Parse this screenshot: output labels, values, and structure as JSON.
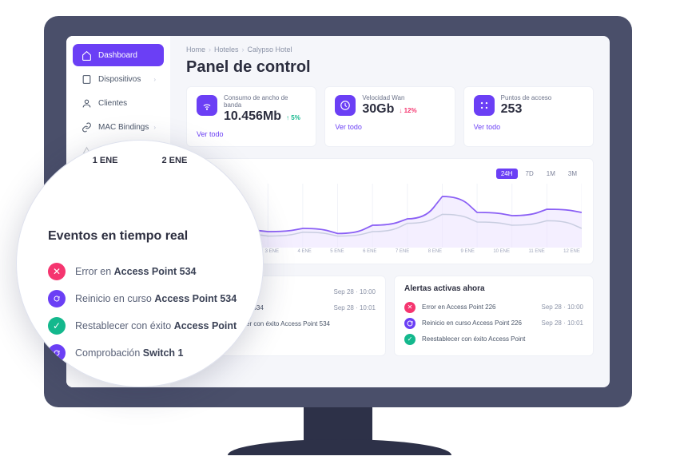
{
  "breadcrumbs": [
    "Home",
    "Hoteles",
    "Calypso Hotel"
  ],
  "pageTitle": "Panel de control",
  "sidebar": {
    "items": [
      {
        "label": "Dashboard",
        "icon": "home",
        "active": true
      },
      {
        "label": "Dispositivos",
        "icon": "device",
        "chev": true
      },
      {
        "label": "Clientes",
        "icon": "user",
        "chev": false
      },
      {
        "label": "MAC Bindings",
        "icon": "link",
        "chev": true
      },
      {
        "label": "",
        "icon": "warn",
        "chev": true
      }
    ]
  },
  "stats": [
    {
      "label": "Consumo de ancho de banda",
      "value": "10.456Mb",
      "change": "5%",
      "dir": "up",
      "icon": "wifi",
      "link": "Ver todo"
    },
    {
      "label": "Velocidad Wan",
      "value": "30Gb",
      "change": "12%",
      "dir": "down",
      "icon": "speed",
      "link": "Ver todo"
    },
    {
      "label": "Puntos de acceso",
      "value": "253",
      "change": "",
      "dir": "",
      "icon": "grid",
      "link": "Ver todo"
    }
  ],
  "chart": {
    "tabs": [
      "24H",
      "7D",
      "1M",
      "3M"
    ],
    "activeTab": 0,
    "xaxis": [
      "1 ENE",
      "2 ENE",
      "3 ENE",
      "4 ENE",
      "5 ENE",
      "6 ENE",
      "7 ENE",
      "8 ENE",
      "9 ENE",
      "10 ENE",
      "11 ENE",
      "12 ENE"
    ]
  },
  "alertsLeft": {
    "title": "",
    "items": [
      {
        "type": "err",
        "text": "534",
        "time": "Sep 28 · 10:00"
      },
      {
        "type": "sync",
        "text": "Access Point 534",
        "time": "Sep 28 · 10:01"
      },
      {
        "type": "ok",
        "text": "Reestablecer con éxito Access Point 534",
        "time": ""
      }
    ]
  },
  "alertsRight": {
    "title": "Alertas activas ahora",
    "items": [
      {
        "type": "err",
        "text": "Error en Access Point 226",
        "time": "Sep 28 · 10:00"
      },
      {
        "type": "sync",
        "text": "Reinicio en curso Access Point 226",
        "time": "Sep 28 · 10:01"
      },
      {
        "type": "ok",
        "text": "Reestablecer con éxito Access Point",
        "time": ""
      }
    ]
  },
  "magnifier": {
    "dates": [
      "1 ENE",
      "2 ENE"
    ],
    "title": "Eventos en tiempo real",
    "items": [
      {
        "type": "err",
        "prefix": "Error en ",
        "bold": "Access Point 534"
      },
      {
        "type": "sync",
        "prefix": "Reinicio en curso ",
        "bold": "Access Point 534"
      },
      {
        "type": "ok",
        "prefix": "Restablecer con éxito ",
        "bold": "Access Point"
      },
      {
        "type": "sync",
        "prefix": "Comprobación ",
        "bold": "Switch 1"
      }
    ]
  },
  "chart_data": {
    "type": "line",
    "title": "",
    "xlabel": "",
    "ylabel": "",
    "x": [
      "1 ENE",
      "2 ENE",
      "3 ENE",
      "4 ENE",
      "5 ENE",
      "6 ENE",
      "7 ENE",
      "8 ENE",
      "9 ENE",
      "10 ENE",
      "11 ENE",
      "12 ENE"
    ],
    "series": [
      {
        "name": "violet",
        "values": [
          20,
          28,
          25,
          30,
          22,
          35,
          45,
          80,
          55,
          50,
          60,
          55
        ]
      },
      {
        "name": "gray",
        "values": [
          15,
          22,
          18,
          24,
          18,
          25,
          38,
          52,
          40,
          35,
          42,
          30
        ]
      }
    ],
    "ylim": [
      0,
      100
    ]
  }
}
